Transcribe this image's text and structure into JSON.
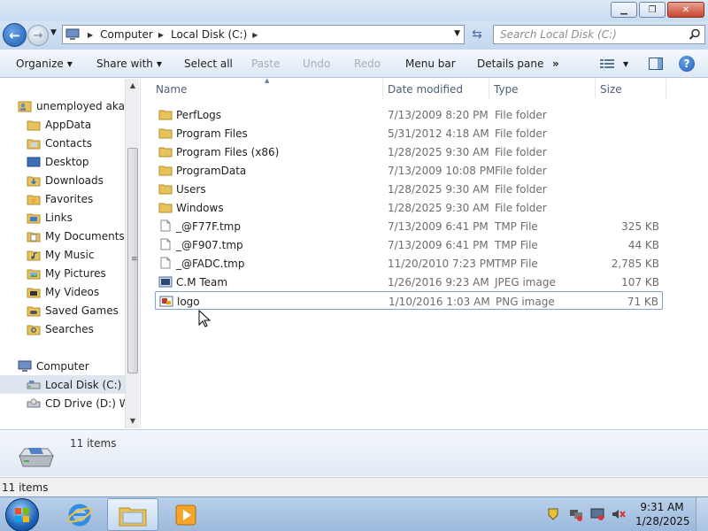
{
  "titlebar": {
    "minimize_label": "▁",
    "maximize_label": "❐",
    "close_label": "✕"
  },
  "address": {
    "crumbs": [
      "Computer",
      "Local Disk (C:)"
    ],
    "search_placeholder": "Search Local Disk (C:)"
  },
  "toolbar": {
    "organize": "Organize",
    "share_with": "Share with",
    "select_all": "Select all",
    "paste": "Paste",
    "undo": "Undo",
    "redo": "Redo",
    "menu_bar": "Menu bar",
    "details_pane": "Details pane",
    "more": "»"
  },
  "navpane": {
    "items": [
      {
        "label": "unemployed aka yo",
        "icon": "user-folder-icon"
      },
      {
        "label": "AppData",
        "icon": "folder-icon"
      },
      {
        "label": "Contacts",
        "icon": "contacts-icon"
      },
      {
        "label": "Desktop",
        "icon": "desktop-icon"
      },
      {
        "label": "Downloads",
        "icon": "downloads-icon"
      },
      {
        "label": "Favorites",
        "icon": "favorites-icon"
      },
      {
        "label": "Links",
        "icon": "links-icon"
      },
      {
        "label": "My Documents",
        "icon": "documents-icon"
      },
      {
        "label": "My Music",
        "icon": "music-icon"
      },
      {
        "label": "My Pictures",
        "icon": "pictures-icon"
      },
      {
        "label": "My Videos",
        "icon": "videos-icon"
      },
      {
        "label": "Saved Games",
        "icon": "saved-games-icon"
      },
      {
        "label": "Searches",
        "icon": "searches-icon"
      },
      {
        "label": "Computer",
        "icon": "computer-icon"
      },
      {
        "label": "Local Disk (C:)",
        "icon": "drive-icon"
      },
      {
        "label": "CD Drive (D:) Wir",
        "icon": "cd-drive-icon"
      }
    ]
  },
  "columns": {
    "name": "Name",
    "date": "Date modified",
    "type": "Type",
    "size": "Size"
  },
  "files": [
    {
      "name": "PerfLogs",
      "date": "7/13/2009 8:20 PM",
      "type": "File folder",
      "size": "",
      "icon": "folder-icon"
    },
    {
      "name": "Program Files",
      "date": "5/31/2012 4:18 AM",
      "type": "File folder",
      "size": "",
      "icon": "folder-icon"
    },
    {
      "name": "Program Files (x86)",
      "date": "1/28/2025 9:30 AM",
      "type": "File folder",
      "size": "",
      "icon": "folder-icon"
    },
    {
      "name": "ProgramData",
      "date": "7/13/2009 10:08 PM",
      "type": "File folder",
      "size": "",
      "icon": "folder-icon"
    },
    {
      "name": "Users",
      "date": "1/28/2025 9:30 AM",
      "type": "File folder",
      "size": "",
      "icon": "folder-icon"
    },
    {
      "name": "Windows",
      "date": "1/28/2025 9:30 AM",
      "type": "File folder",
      "size": "",
      "icon": "folder-icon"
    },
    {
      "name": "_@F77F.tmp",
      "date": "7/13/2009 6:41 PM",
      "type": "TMP File",
      "size": "325 KB",
      "icon": "file-icon"
    },
    {
      "name": "_@F907.tmp",
      "date": "7/13/2009 6:41 PM",
      "type": "TMP File",
      "size": "44 KB",
      "icon": "file-icon"
    },
    {
      "name": "_@FADC.tmp",
      "date": "11/20/2010 7:23 PM",
      "type": "TMP File",
      "size": "2,785 KB",
      "icon": "file-icon"
    },
    {
      "name": "C.M Team",
      "date": "1/26/2016 9:23 AM",
      "type": "JPEG image",
      "size": "107 KB",
      "icon": "jpeg-icon"
    },
    {
      "name": "logo",
      "date": "1/10/2016 1:03 AM",
      "type": "PNG image",
      "size": "71 KB",
      "icon": "png-icon"
    }
  ],
  "details": {
    "count_text": "11 items"
  },
  "status": {
    "text": "11 items"
  },
  "taskbar": {
    "time": "9:31 AM",
    "date": "1/28/2025"
  },
  "colors": {
    "accent": "#1d5cb3",
    "folder": "#e8c25a",
    "selection": "#dde5ee"
  }
}
